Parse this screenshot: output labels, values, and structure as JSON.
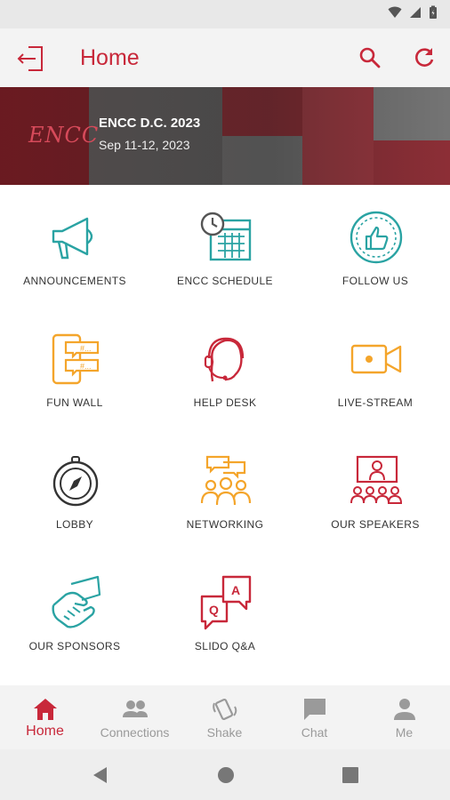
{
  "header": {
    "title": "Home"
  },
  "banner": {
    "logo_text": "ENCC",
    "event_title": "ENCC D.C. 2023",
    "event_dates": "Sep 11-12, 2023"
  },
  "grid": {
    "items": [
      {
        "label": "ANNOUNCEMENTS",
        "icon": "megaphone-icon",
        "color": "#2aa3a3"
      },
      {
        "label": "ENCC SCHEDULE",
        "icon": "calendar-clock-icon",
        "color": "#2aa3a3"
      },
      {
        "label": "FOLLOW US",
        "icon": "thumbs-up-icon",
        "color": "#2aa3a3"
      },
      {
        "label": "FUN WALL",
        "icon": "chat-wall-icon",
        "color": "#f4a52b"
      },
      {
        "label": "HELP DESK",
        "icon": "headset-icon",
        "color": "#c8283a"
      },
      {
        "label": "LIVE-STREAM",
        "icon": "video-camera-icon",
        "color": "#f4a52b"
      },
      {
        "label": "LOBBY",
        "icon": "compass-icon",
        "color": "#333333"
      },
      {
        "label": "NETWORKING",
        "icon": "people-chat-icon",
        "color": "#f4a52b"
      },
      {
        "label": "OUR SPEAKERS",
        "icon": "presentation-icon",
        "color": "#c8283a"
      },
      {
        "label": "OUR SPONSORS",
        "icon": "handshake-icon",
        "color": "#2aa3a3"
      },
      {
        "label": "SLIDO Q&A",
        "icon": "qa-bubbles-icon",
        "color": "#c8283a"
      }
    ]
  },
  "nav": {
    "items": [
      {
        "label": "Home",
        "icon": "home-icon",
        "active": true
      },
      {
        "label": "Connections",
        "icon": "people-icon",
        "active": false
      },
      {
        "label": "Shake",
        "icon": "shake-phone-icon",
        "active": false
      },
      {
        "label": "Chat",
        "icon": "chat-icon",
        "active": false
      },
      {
        "label": "Me",
        "icon": "person-icon",
        "active": false
      }
    ]
  },
  "colors": {
    "accent": "#c8283a",
    "teal": "#2aa3a3",
    "orange": "#f4a52b",
    "nav_inactive": "#9a9a9a"
  }
}
